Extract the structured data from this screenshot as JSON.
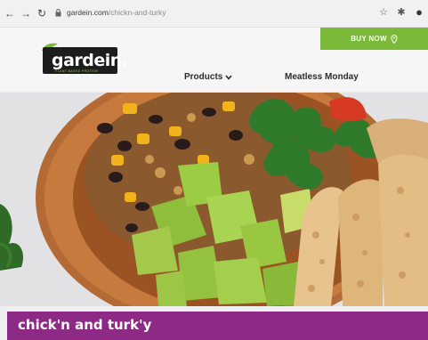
{
  "browser": {
    "back_icon": "back-arrow-icon",
    "forward_icon": "forward-arrow-icon",
    "reload_icon": "reload-icon",
    "url_domain": "gardein.com",
    "url_path": "/chickn-and-turky",
    "bookmark_icon": "star-icon",
    "extensions_icon": "puzzle-icon",
    "profile_icon": "profile-icon"
  },
  "header": {
    "buy_now_label": "BUY NOW",
    "logo_text": "gardein.",
    "logo_tagline": "PLANT-BASED PROTEIN",
    "nav": {
      "products_label": "Products",
      "meatless_label": "Meatless Monday"
    }
  },
  "hero": {
    "image_alt": "bowl with avocado, black beans, corn, cilantro and sliced chick'n"
  },
  "page": {
    "title": "chick'n and turk'y"
  },
  "colors": {
    "accent_green": "#7bb938",
    "title_band_purple": "#8d2a86",
    "logo_black": "#1d1d1d"
  }
}
